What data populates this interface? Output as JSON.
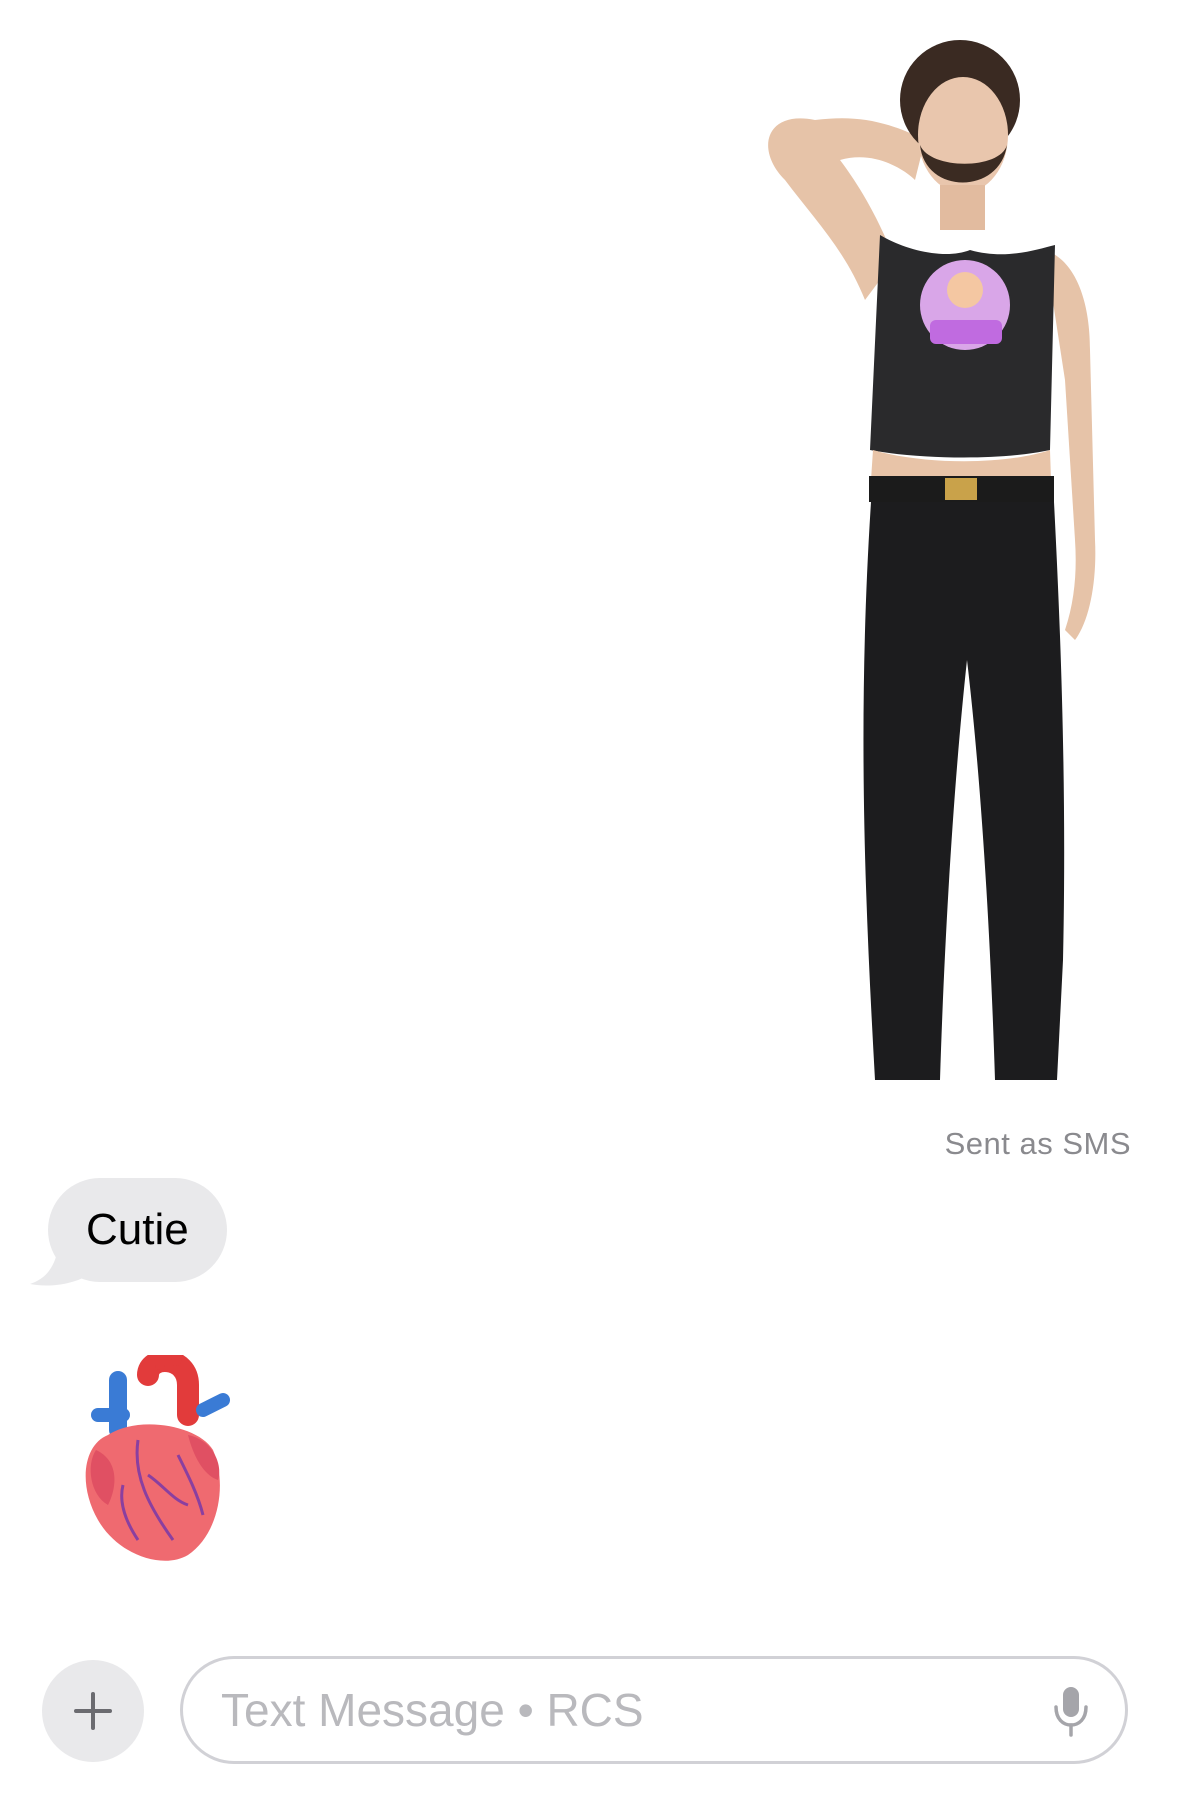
{
  "conversation": {
    "sent_sticker": {
      "icon": "person-photo-sticker",
      "delivery_status": "Sent as SMS"
    },
    "received": [
      {
        "type": "text",
        "text": "Cutie"
      },
      {
        "type": "emoji",
        "icon": "anatomical-heart-emoji"
      }
    ]
  },
  "composer": {
    "plus_icon": "plus-icon",
    "placeholder": "Text Message • RCS",
    "mic_icon": "microphone-icon"
  },
  "colors": {
    "bubble_received": "#e9e9eb",
    "status_text": "#8a8a8e",
    "placeholder_text": "#b9b9bd",
    "field_border": "#d1d1d6"
  }
}
